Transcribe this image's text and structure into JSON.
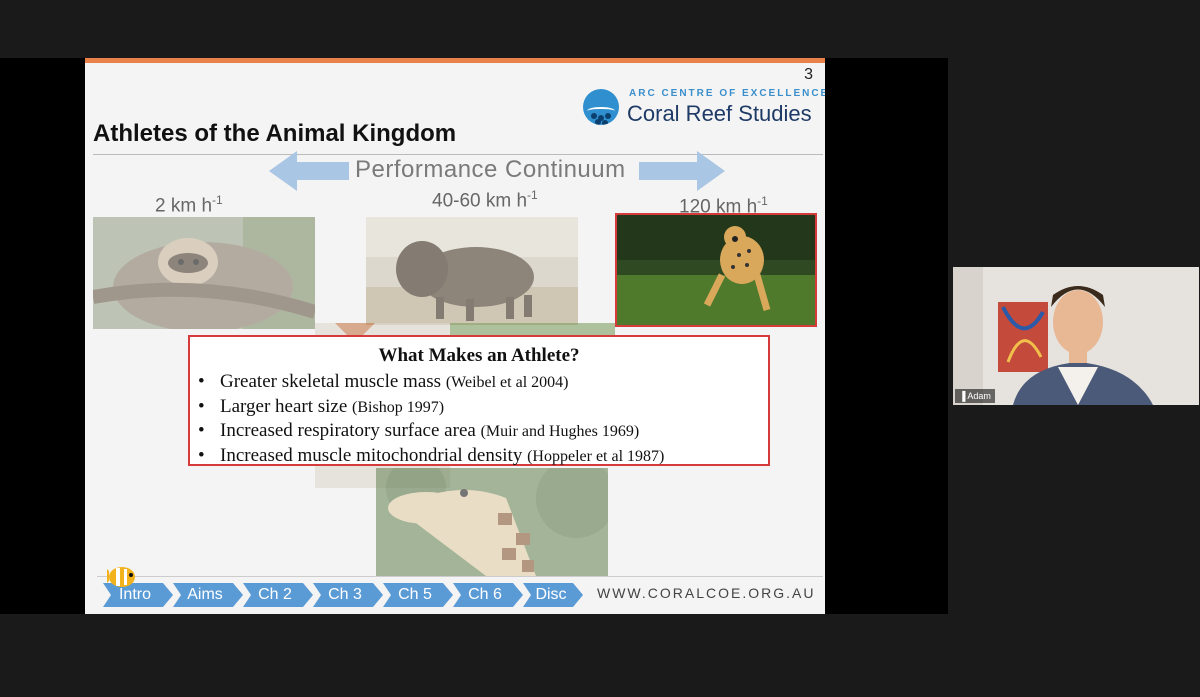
{
  "slide": {
    "number": "3",
    "logo_top": "ARC CENTRE OF EXCELLENCE",
    "logo_main": "Coral Reef Studies",
    "title": "Athletes of the Animal Kingdom",
    "continuum": "Performance Continuum",
    "speeds": {
      "sloth": "2 km h",
      "bison": "40-60 km h",
      "cheetah": "120 km h",
      "exponent": "-1"
    },
    "info_box": {
      "title": "What Makes an Athlete?",
      "items": [
        {
          "text": "Greater skeletal muscle mass",
          "cite": "(Weibel et al 2004)"
        },
        {
          "text": "Larger heart size",
          "cite": "(Bishop 1997)"
        },
        {
          "text": "Increased respiratory surface area",
          "cite": "(Muir and Hughes 1969)"
        },
        {
          "text": "Increased muscle mitochondrial density",
          "cite": "(Hoppeler et al 1987)"
        }
      ]
    },
    "nav": [
      "Intro",
      "Aims",
      "Ch 2",
      "Ch 3",
      "Ch 5",
      "Ch 6",
      "Disc"
    ],
    "website": "WWW.CORALCOE.ORG.AU"
  },
  "participant": {
    "name": "Adam",
    "signal_icon": "signal-bars-icon"
  },
  "colors": {
    "accent_bar": "#e8824a",
    "nav_blue": "#5b9bd5",
    "highlight_red": "#d63b3b",
    "logo_navy": "#1e3a66"
  }
}
